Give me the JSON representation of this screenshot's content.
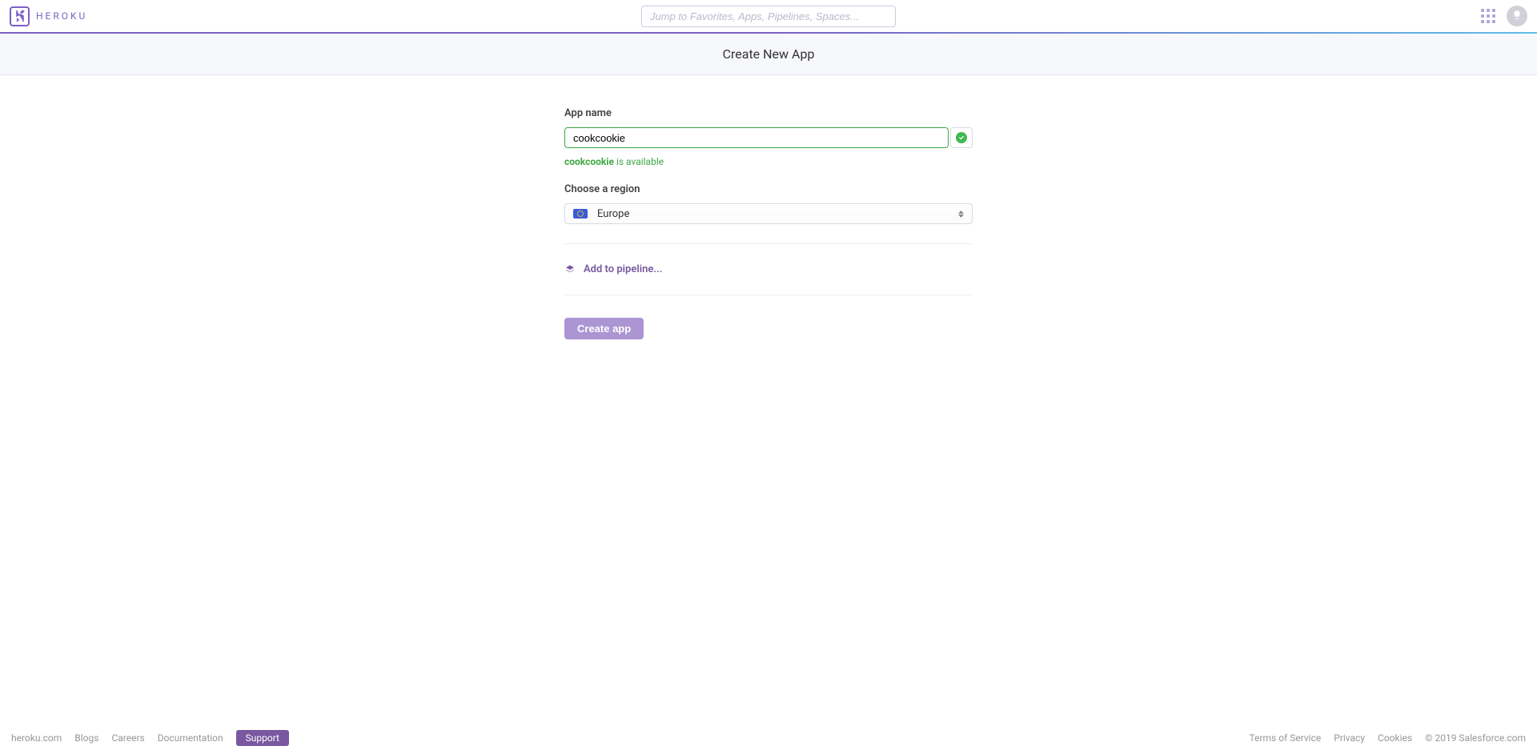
{
  "header": {
    "brand": "HEROKU",
    "search_placeholder": "Jump to Favorites, Apps, Pipelines, Spaces..."
  },
  "subheader": {
    "title": "Create New App"
  },
  "form": {
    "app_name_label": "App name",
    "app_name_value": "cookcookie",
    "availability_name": "cookcookie",
    "availability_suffix": " is available",
    "region_label": "Choose a region",
    "region_selected": "Europe",
    "pipeline_label": "Add to pipeline...",
    "create_label": "Create app"
  },
  "footer": {
    "left": [
      "heroku.com",
      "Blogs",
      "Careers",
      "Documentation"
    ],
    "support": "Support",
    "right": [
      "Terms of Service",
      "Privacy",
      "Cookies"
    ],
    "copyright": "© 2019 Salesforce.com"
  }
}
